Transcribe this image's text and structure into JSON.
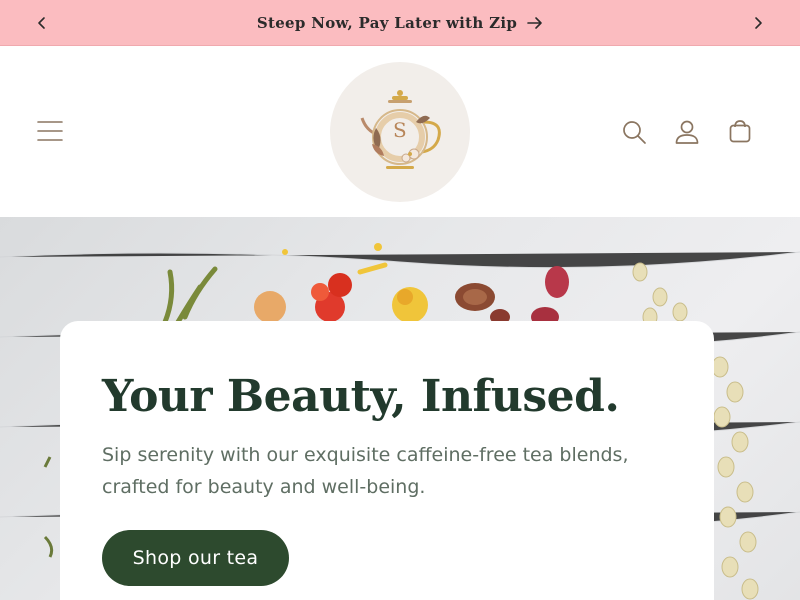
{
  "announcement": {
    "message": "Steep Now, Pay Later with Zip",
    "prev_icon": "chevron-left-icon",
    "next_icon": "chevron-right-icon",
    "arrow_icon": "arrow-right-icon",
    "background": "#fbbcc0"
  },
  "header": {
    "logo_letter": "S",
    "icons": [
      "menu-icon",
      "search-icon",
      "account-icon",
      "cart-icon"
    ],
    "icon_color": "#8a7560"
  },
  "hero": {
    "title": "Your Beauty, Infused.",
    "description": "Sip serenity with our exquisite caffeine-free tea blends, crafted for beauty and well-being.",
    "cta_label": "Shop our tea",
    "title_color": "#223a2d",
    "cta_color": "#2d4a2e"
  }
}
